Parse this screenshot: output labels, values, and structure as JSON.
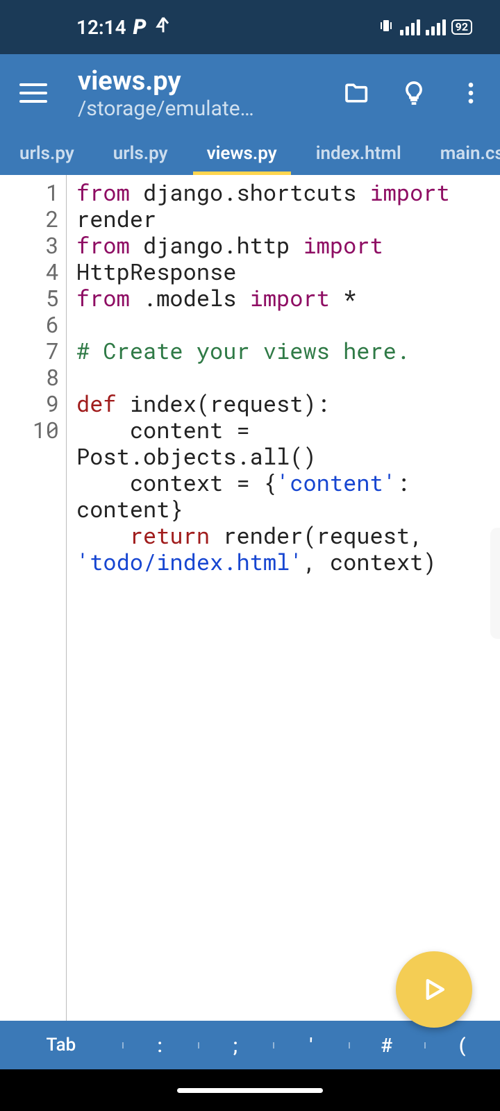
{
  "status": {
    "time": "12:14",
    "battery": "92"
  },
  "appbar": {
    "title": "views.py",
    "path": "/storage/emulate…"
  },
  "tabs": [
    {
      "label": "urls.py",
      "active": false
    },
    {
      "label": "urls.py",
      "active": false
    },
    {
      "label": "views.py",
      "active": true
    },
    {
      "label": "index.html",
      "active": false
    },
    {
      "label": "main.css",
      "active": false
    }
  ],
  "lines": [
    "1",
    "2",
    "3",
    "4",
    "5",
    "6",
    "7",
    "8",
    "9",
    "10"
  ],
  "code": {
    "l1_from": "from",
    "l1_mod": " django.shortcuts ",
    "l1_import": "import",
    "l1_name": " render",
    "l2_from": "from",
    "l2_mod": " django.http ",
    "l2_import": "import",
    "l2_name": " HttpResponse",
    "l3_from": "from",
    "l3_mod": " .models ",
    "l3_import": "import",
    "l3_star": " *",
    "l5_comment": "# Create your views here.",
    "l7_def": "def",
    "l7_sig": " index(request):",
    "l8": "    content = Post.objects.all()",
    "l9_a": "    context = {",
    "l9_str": "'content'",
    "l9_b": ": content}",
    "l10_ret": "return",
    "l10_a": " render(request, ",
    "l10_str": "'todo/index.html'",
    "l10_b": ", context)"
  },
  "keys": {
    "tab": "Tab",
    "colon": ":",
    "semicolon": ";",
    "apostrophe": "'",
    "hash": "#",
    "paren": "("
  }
}
